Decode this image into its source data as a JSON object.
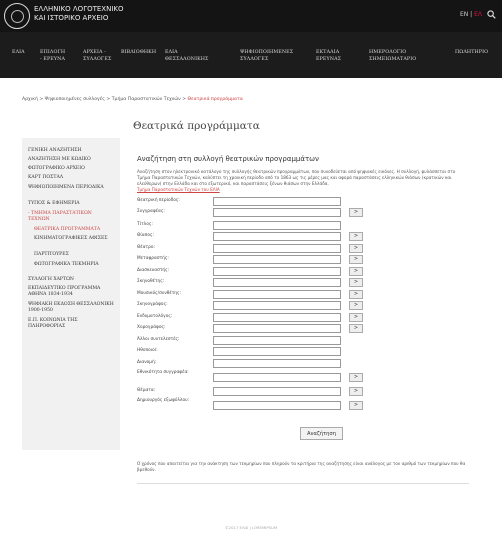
{
  "header": {
    "org_name_line1": "ΕΛΛΗΝΙΚΟ ΛΟΓΟΤΕΧΝΙΚΟ",
    "org_name_line2": "ΚΑΙ ΙΣΤΟΡΙΚΟ ΑΡΧΕΙΟ",
    "lang_en": "EN",
    "lang_sep": " | ",
    "lang_gr": "ΕΛ",
    "search_icon": "search-icon"
  },
  "nav": [
    {
      "line1": "ΕΛΙΑ",
      "line2": ""
    },
    {
      "line1": "ΕΠΙΛΟΓΗ",
      "line2": "- ΕΡΕΥΝΑ"
    },
    {
      "line1": "ΑΡΧΕΙΑ -",
      "line2": "ΣΥΛΛΟΓΕΣ"
    },
    {
      "line1": "ΒΙΒΛΙΟΘΗΚΗ",
      "line2": ""
    },
    {
      "line1": "ΕΛΙΑ",
      "line2": "ΘΕΣΣΑΛΟΝΙΚΗΣ"
    },
    {
      "line1": "ΨΗΦΙΟΠΟΙΗΜΕΝΕΣ",
      "line2": "ΣΥΛΛΟΓΕΣ"
    },
    {
      "line1": "ΕΚΤΑΛΙΑ",
      "line2": "ΕΡΕΥΝΑΣ"
    },
    {
      "line1": "ΗΜΕΡΟΛΟΓΙΟ",
      "line2": "ΣΗΜΕΙΩΜΑΤΑΡΙΟ"
    },
    {
      "line1": "ΠΩΛΗΤΗΡΙΟ",
      "line2": ""
    }
  ],
  "breadcrumb": {
    "trail": "Αρχική > Ψηφιοποιημένες συλλογές > Τμήμα Παραστατικών Τεχνών > ",
    "current": "Θεατρικά προγράμματα"
  },
  "sidebar": [
    {
      "label": "ΓΕΝΙΚΗ ΑΝΑΖΗΤΗΣΗ",
      "sub": false,
      "red": false
    },
    {
      "label": "ΑΝΑΖΗΤΗΣΗ ΜΕ ΚΩΔΙΚΟ",
      "sub": false,
      "red": false
    },
    {
      "label": "ΦΩΤΟΓΡΑΦΙΚΟ ΑΡΧΕΙΟ",
      "sub": false,
      "red": false
    },
    {
      "label": "ΚΑΡΤ ΠΟΣΤΑΛ",
      "sub": false,
      "red": false
    },
    {
      "label": "ΨΗΦΙΟΠΟΙΗΜΕΝΑ ΠΕΡΙΟΔΙΚΑ",
      "sub": false,
      "red": false
    },
    {
      "label": "ΤΥΠΟΣ & ΕΦΗΜΕΡΙΑ",
      "sub": false,
      "red": false
    },
    {
      "label": "- ΤΜΗΜΑ ΠΑΡΑΣΤΑΤΙΚΩΝ ΤΕΧΝΩΝ",
      "sub": false,
      "red": true
    },
    {
      "label": "ΘΕΑΤΡΙΚΑ ΠΡΟΓΡΑΜΜΑΤΑ",
      "sub": true,
      "red": true
    },
    {
      "label": "ΚΙΝΗΜΑΤΟΓΡΑΦΙΚΕΣ ΑΦΙΣΕΣ",
      "sub": true,
      "red": false
    },
    {
      "label": "ΠΑΡΤΙΤΟΥΡΕΣ",
      "sub": true,
      "red": false
    },
    {
      "label": "ΦΩΤΟΓΡΑΦΙΚΑ ΤΕΚΜΗΡΙΑ",
      "sub": true,
      "red": false
    },
    {
      "label": "ΣΥΛΛΟΓΗ ΧΑΡΤΩΝ",
      "sub": false,
      "red": false
    },
    {
      "label": "ΕΚΠΑΙΔΕΥΤΙΚΟ ΠΡΟΓΡΑΜΜΑ ΑΘΗΝΑ 1834-1934",
      "sub": false,
      "red": false
    },
    {
      "label": "ΨΗΦΙΑΚΗ ΕΚΔΟΣΗ ΘΕΣΣΑΛΟΝΙΚΗ 1900-1950",
      "sub": false,
      "red": false
    },
    {
      "label": "Ε.Π. ΚΟΙΝΩΝΙΑ ΤΗΣ ΠΛΗΡΟΦΟΡΙΑΣ",
      "sub": false,
      "red": false
    }
  ],
  "content": {
    "page_title": "Θεατρικά προγράμματα",
    "section_title": "Αναζήτηση στη συλλογή θεατρικών προγραμμάτων",
    "intro": "Αναζήτηση στον ηλεκτρονικό κατάλογο της συλλογής θεατρικών προγραμμάτων, που συνοδεύεται από ψηφιακές εικόνες. Η συλλογή, φυλάσσεται στο Τμήμα Παραστατικών Τεχνών, καλύπτει τη χρονική περίοδο από το 1863 ως τις μέρες μας και αφορά παραστάσεις ελληνικών θιάσων (κρατικών και ελεύθερων) στην Ελλάδα και στο εξωτερικό, και παραστάσεις ξένων θιάσων στην Ελλάδα.",
    "intro_link": "Τμήμα Παραστατικών Τεχνών του ΕΛΙΑ",
    "fields": [
      {
        "label": "Θεατρική περίοδος:",
        "picker": false
      },
      {
        "label": "Συγγραφέας:",
        "picker": true
      },
      {
        "label": "Τίτλος:",
        "picker": false
      },
      {
        "label": "Θίασος:",
        "picker": true
      },
      {
        "label": "Θέατρο:",
        "picker": true
      },
      {
        "label": "Μεταφραστής:",
        "picker": true
      },
      {
        "label": "Διασκευαστής:",
        "picker": true
      },
      {
        "label": "Σκηνοθέτης:",
        "picker": true
      },
      {
        "label": "Μουσικός/συνθέτης:",
        "picker": true
      },
      {
        "label": "Σκηνογράφος:",
        "picker": true
      },
      {
        "label": "Ενδυματολόγος:",
        "picker": true
      },
      {
        "label": "Χορογράφος:",
        "picker": true
      },
      {
        "label": "Άλλοι συντελεστές:",
        "picker": false
      },
      {
        "label": "Ηθοποιοί:",
        "picker": false
      },
      {
        "label": "Διανομή:",
        "picker": false
      },
      {
        "label": "Εθνικότητα συγγραφέα:",
        "picker": true
      },
      {
        "label": "Θέματα:",
        "picker": true
      },
      {
        "label": "Δημιουργός εξωφύλλου:",
        "picker": true
      }
    ],
    "picker_label": ">",
    "submit_label": "Αναζήτηση",
    "note": "Ο χρόνος που απαιτείται για την ανάκτηση των τεκμηρίων που πληρούν τα κριτήρια της αναζήτησης είναι ανάλογος με τον αριθμό των τεκμηρίων που θα βρεθούν."
  },
  "footer": "©2017 ΕΛΙΑ | LOREMIPSUM",
  "colors": {
    "accent": "#cc4444",
    "header_bg": "#141414",
    "sidebar_bg": "#f1f1f1"
  }
}
